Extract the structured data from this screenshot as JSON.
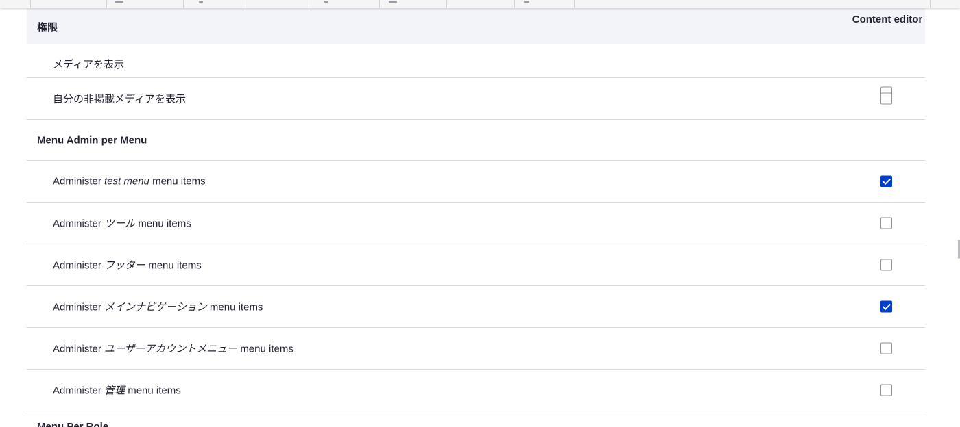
{
  "header": {
    "permission_column": "権限",
    "role_column": "Content editor"
  },
  "rows": [
    {
      "type": "permission",
      "label": "メディアを表示",
      "checked": false
    },
    {
      "type": "permission",
      "label": "自分の非掲載メディアを表示",
      "checked": false
    },
    {
      "type": "module",
      "label": "Menu Admin per Menu"
    },
    {
      "type": "permission",
      "prefix": "Administer",
      "menu": "test menu",
      "suffix": "menu items",
      "checked": true
    },
    {
      "type": "permission",
      "prefix": "Administer",
      "menu": "ツール",
      "suffix": "menu items",
      "checked": false
    },
    {
      "type": "permission",
      "prefix": "Administer",
      "menu": "フッター",
      "suffix": "menu items",
      "checked": false
    },
    {
      "type": "permission",
      "prefix": "Administer",
      "menu": "メインナビゲーション",
      "suffix": "menu items",
      "checked": true
    },
    {
      "type": "permission",
      "prefix": "Administer",
      "menu": "ユーザーアカウントメニュー",
      "suffix": "menu items",
      "checked": false
    },
    {
      "type": "permission",
      "prefix": "Administer",
      "menu": "管理",
      "suffix": "menu items",
      "checked": false
    }
  ],
  "next_module_partial": "Menu Per Role",
  "colors": {
    "checkbox_checked": "#003ecc",
    "header_bg": "#f3f4f9",
    "row_border": "#d8d9de"
  }
}
